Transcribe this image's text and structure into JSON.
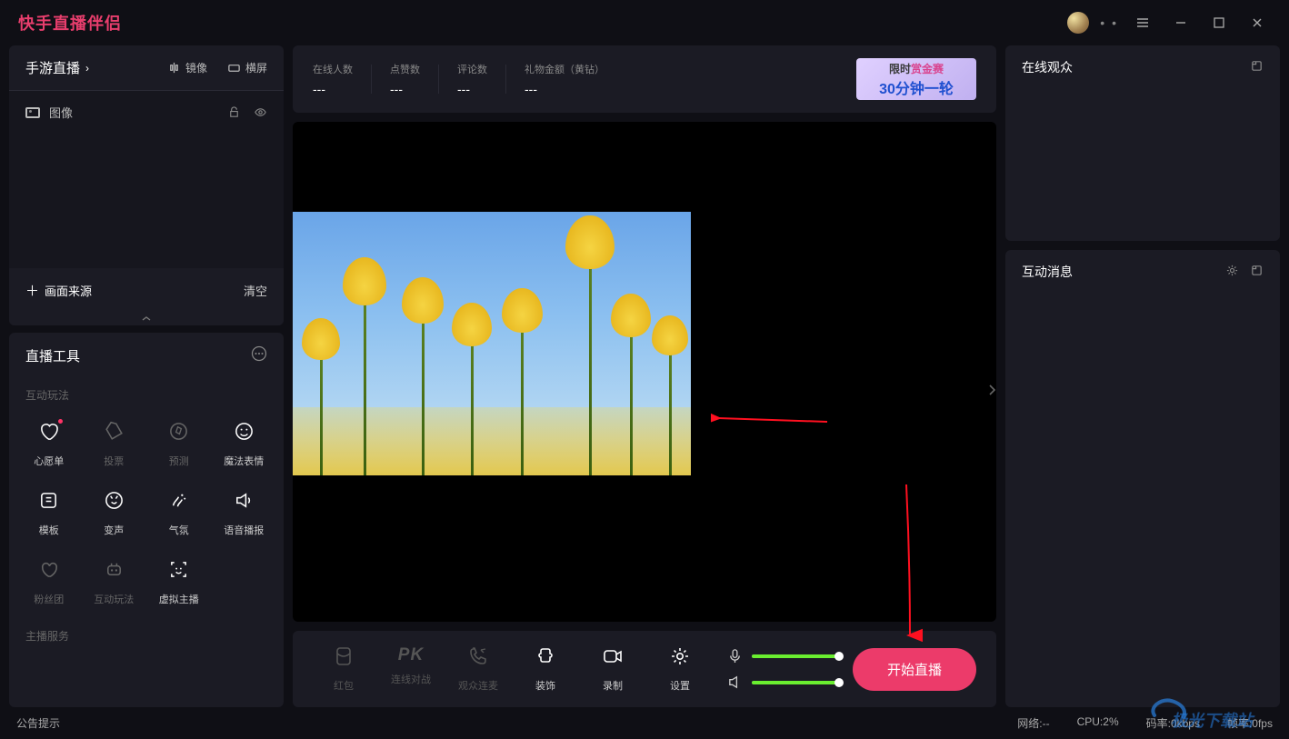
{
  "titlebar": {
    "app_title": "快手直播伴侣"
  },
  "scene": {
    "title": "手游直播",
    "mirror": "镜像",
    "landscape": "横屏",
    "layer_image": "图像",
    "add_source": "画面来源",
    "clear": "清空"
  },
  "tools": {
    "header": "直播工具",
    "section_interactive": "互动玩法",
    "section_host": "主播服务",
    "items": [
      {
        "label": "心愿单",
        "icon": "heart-icon",
        "active": true,
        "badge": true
      },
      {
        "label": "投票",
        "icon": "tag-icon",
        "active": false
      },
      {
        "label": "预测",
        "icon": "compass-icon",
        "active": false
      },
      {
        "label": "魔法表情",
        "icon": "smile-icon",
        "active": true
      },
      {
        "label": "模板",
        "icon": "template-icon",
        "active": true
      },
      {
        "label": "变声",
        "icon": "voice-change-icon",
        "active": true
      },
      {
        "label": "气氛",
        "icon": "sparkle-icon",
        "active": true
      },
      {
        "label": "语音播报",
        "icon": "speaker-icon",
        "active": true
      },
      {
        "label": "粉丝团",
        "icon": "fans-heart-icon",
        "active": false
      },
      {
        "label": "互动玩法",
        "icon": "robot-icon",
        "active": false
      },
      {
        "label": "虚拟主播",
        "icon": "face-scan-icon",
        "active": true
      }
    ]
  },
  "stats": [
    {
      "label": "在线人数",
      "value": "---"
    },
    {
      "label": "点赞数",
      "value": "---"
    },
    {
      "label": "评论数",
      "value": "---"
    },
    {
      "label": "礼物金额（黄钻）",
      "value": "---"
    }
  ],
  "promo": {
    "line1_pre": "限时",
    "line1_hl": "赏金赛",
    "line2": "30分钟一轮"
  },
  "bottom_tools": [
    {
      "label": "红包",
      "icon": "red-packet-icon",
      "active": false
    },
    {
      "label": "连线对战",
      "icon": "pk-icon",
      "active": false,
      "pk": true
    },
    {
      "label": "观众连麦",
      "icon": "call-icon",
      "active": false
    },
    {
      "label": "装饰",
      "icon": "puzzle-icon",
      "active": true
    },
    {
      "label": "录制",
      "icon": "record-icon",
      "active": true
    },
    {
      "label": "设置",
      "icon": "gear-icon",
      "active": true
    }
  ],
  "start_button": "开始直播",
  "right": {
    "audience": "在线观众",
    "messages": "互动消息"
  },
  "status": {
    "announcement": "公告提示",
    "network": "网络:--",
    "cpu": "CPU:2%",
    "bitrate": "码率:0kbps",
    "framerate": "帧率:0fps"
  },
  "watermark": "极光下载站"
}
